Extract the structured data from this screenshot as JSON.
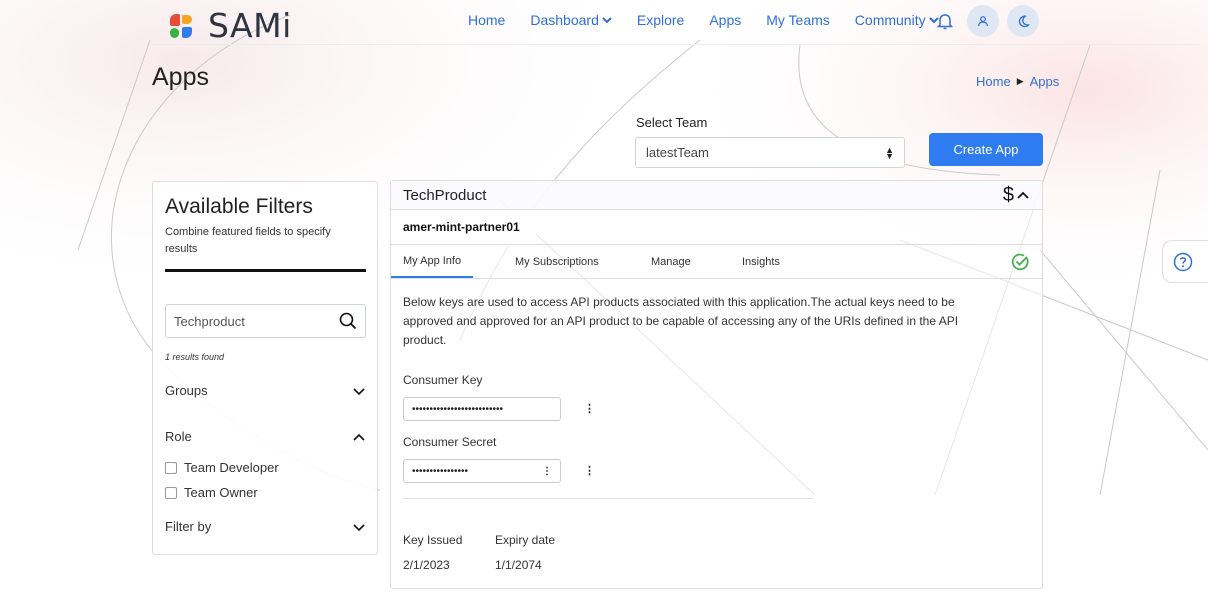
{
  "brand": {
    "name": "SAMi"
  },
  "nav": {
    "items": [
      {
        "label": "Home",
        "dropdown": false
      },
      {
        "label": "Dashboard",
        "dropdown": true
      },
      {
        "label": "Explore",
        "dropdown": false
      },
      {
        "label": "Apps",
        "dropdown": false
      },
      {
        "label": "My Teams",
        "dropdown": false
      },
      {
        "label": "Community",
        "dropdown": true
      }
    ],
    "icons": [
      "bell-icon",
      "user-icon",
      "moon-icon"
    ]
  },
  "page": {
    "title": "Apps",
    "breadcrumb": {
      "home": "Home",
      "current": "Apps"
    }
  },
  "team": {
    "label": "Select Team",
    "selected": "latestTeam"
  },
  "actions": {
    "create_app": "Create App"
  },
  "filters": {
    "title": "Available Filters",
    "subtitle": "Combine featured fields to specify results",
    "search_value": "Techproduct",
    "results": "1 results found",
    "groups": "Groups",
    "role": "Role",
    "roles": [
      "Team Developer",
      "Team Owner"
    ],
    "filter_by": "Filter by"
  },
  "app": {
    "product": "TechProduct",
    "partner": "amer-mint-partner01",
    "tabs": [
      "My App Info",
      "My Subscriptions",
      "Manage",
      "Insights"
    ],
    "active_tab": "My App Info",
    "description": "Below keys are used to access API products associated with this application.The actual keys need to be approved and approved for an API product to be capable of accessing any of the URIs defined in the API product.",
    "consumer_key_label": "Consumer Key",
    "consumer_key_value": "••••••••••••••••••••••••••",
    "consumer_secret_label": "Consumer Secret",
    "consumer_secret_value": "••••••••••••••••",
    "key_issued_label": "Key Issued",
    "key_issued": "2/1/2023",
    "expiry_label": "Expiry date",
    "expiry": "1/1/2074"
  },
  "colors": {
    "accent": "#2f7cf0",
    "link": "#2f6fd6",
    "success": "#3cb043"
  }
}
